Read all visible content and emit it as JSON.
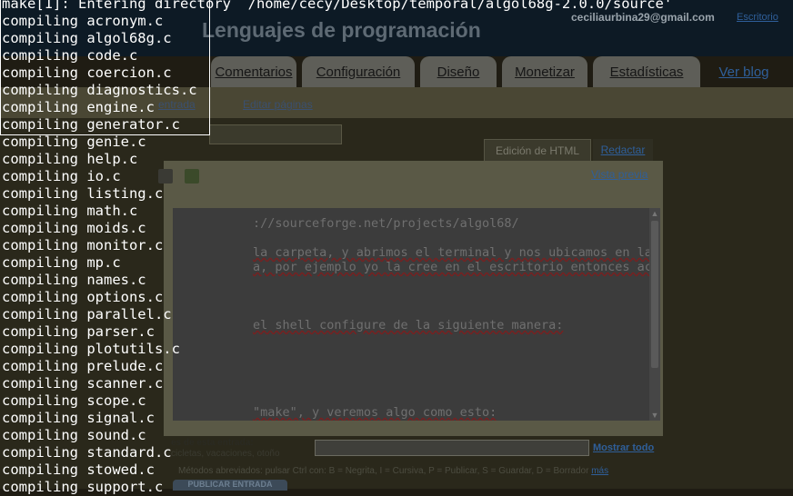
{
  "header": {
    "title": "Lenguajes de programación",
    "email": "ceciliaurbina29@gmail.com",
    "escritorio_link": "Escritorio"
  },
  "main_tabs": [
    {
      "label": "Comentarios"
    },
    {
      "label": "Configuración"
    },
    {
      "label": "Diseño"
    },
    {
      "label": "Monetizar"
    },
    {
      "label": "Estadísticas"
    },
    {
      "label": "Ver blog"
    }
  ],
  "subnav": {
    "new_post_link": "entrada",
    "edit_pages_link": "Editar páginas"
  },
  "editor": {
    "tab_html": "Edición de HTML",
    "tab_compose": "Redactar",
    "preview_link": "Vista previa",
    "visible_lines": [
      "://sourceforge.net/projects/algol68/",
      "la carpeta, y abrimos el terminal y nos ubicamos en la dirección de",
      "a, por ejemplo yo la cree en el escritorio entonces accedo de esta",
      "el shell configure de la siguiente manera:",
      "\"make\", y veremos algo como esto:"
    ]
  },
  "labels_section": {
    "label": "es de esta entrada:",
    "example": "cicletas, vacaciones, otoño",
    "show_all_link": "Mostrar todo"
  },
  "shortcuts_text": "Métodos abreviados: pulsar Ctrl con: B = Negrita, I = Cursiva, P = Publicar, S = Guardar, D = Borrador",
  "shortcuts_more_link": "más",
  "publish_button": "PUBLICAR ENTRADA",
  "terminal": {
    "lines": [
      "make[1]: Entering directory `/home/cecy/Desktop/temporal/algol68g-2.0.0/source'",
      "compiling acronym.c",
      "compiling algol68g.c",
      "compiling code.c",
      "compiling coercion.c",
      "compiling diagnostics.c",
      "compiling engine.c",
      "compiling generator.c",
      "compiling genie.c",
      "compiling help.c",
      "compiling io.c",
      "compiling listing.c",
      "compiling math.c",
      "compiling moids.c",
      "compiling monitor.c",
      "compiling mp.c",
      "compiling names.c",
      "compiling options.c",
      "compiling parallel.c",
      "compiling parser.c",
      "compiling plotutils.c",
      "compiling prelude.c",
      "compiling scanner.c",
      "compiling scope.c",
      "compiling signal.c",
      "compiling sound.c",
      "compiling standard.c",
      "compiling stowed.c",
      "compiling support.c"
    ]
  },
  "colors": {
    "terminal_text": "#ffffff",
    "link_blue": "#2f5f9a",
    "dim_background": "#1f1c13"
  }
}
